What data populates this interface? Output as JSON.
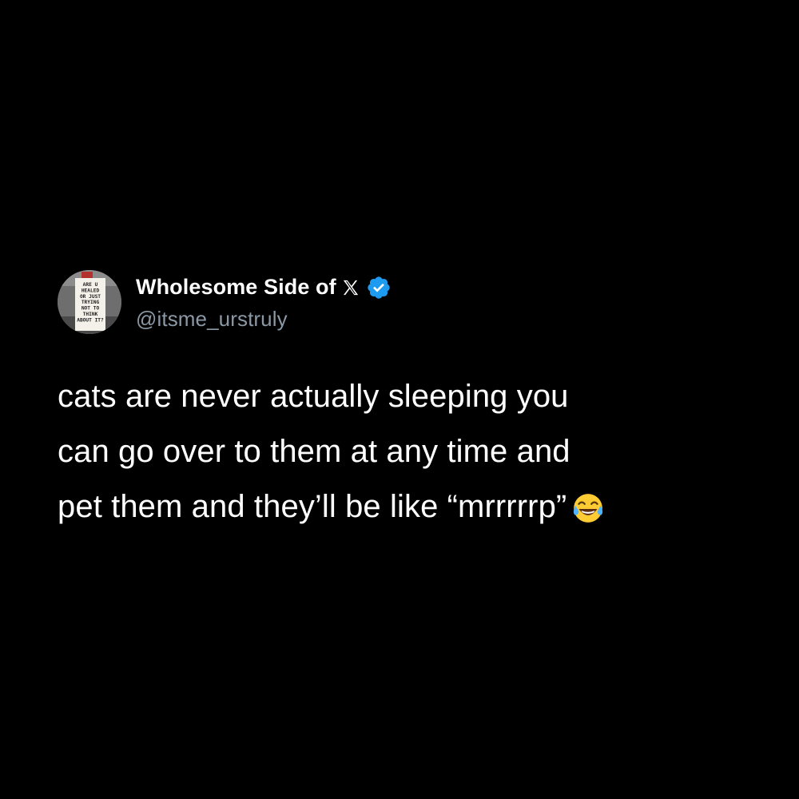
{
  "tweet": {
    "author": {
      "display_name": "Wholesome Side of",
      "handle": "@itsme_urstruly",
      "verified": true,
      "platform_icon": "x-logo-icon",
      "avatar_sign_text": [
        "ARE U",
        "HEALED",
        "OR JUST",
        "TRYING",
        "NOT TO",
        "THINK",
        "ABOUT IT?"
      ]
    },
    "text_lines": [
      "cats are never actually sleeping you",
      "can go over to them at any time and",
      "pet them and they’ll be like “mrrrrrp”"
    ],
    "emoji": "face-with-tears-of-joy-icon"
  },
  "colors": {
    "background": "#000000",
    "text": "#ffffff",
    "handle": "#8b98a5",
    "verified": "#1d9bf0"
  }
}
